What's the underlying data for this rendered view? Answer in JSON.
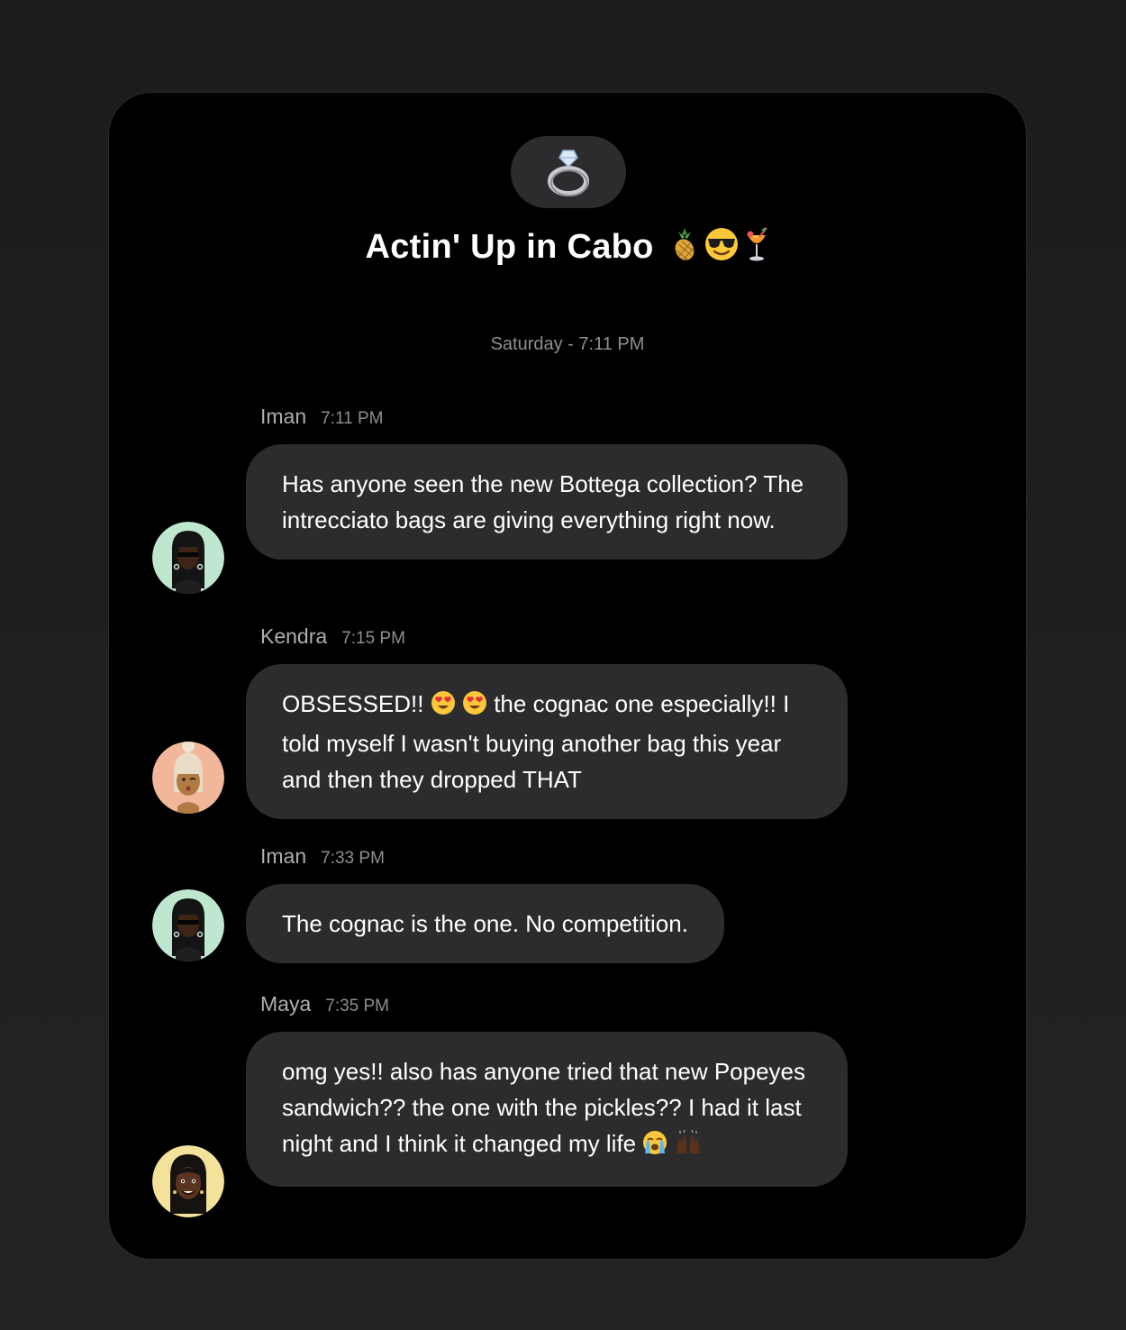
{
  "group": {
    "icon": "ring-icon",
    "title": "Actin' Up in Cabo",
    "title_emoji": [
      "pineapple-icon",
      "sunglasses-face-icon",
      "tropical-drink-icon"
    ]
  },
  "date_separator": "Saturday - 7:11 PM",
  "messages": [
    {
      "sender": "Iman",
      "time": "7:11 PM",
      "avatar": "iman-avatar",
      "text": "Has anyone seen the new Bottega collection? The intrecciato bags are giving everything right now."
    },
    {
      "sender": "Kendra",
      "time": "7:15 PM",
      "avatar": "kendra-avatar",
      "text_a": "OBSESSED!!",
      "text_b": "the cognac one especially!! I told myself I wasn't buying another bag this year and then they dropped THAT"
    },
    {
      "sender": "Iman",
      "time": "7:33 PM",
      "avatar": "iman-avatar",
      "text": "The cognac is the one. No competition."
    },
    {
      "sender": "Maya",
      "time": "7:35 PM",
      "avatar": "maya-avatar",
      "text": "omg yes!! also has anyone tried that new Popeyes sandwich?? the one with the pickles?? I had it last night and I think it changed my life"
    }
  ],
  "colors": {
    "background": "#1c1c1e",
    "window": "#000000",
    "bubble": "#2c2c2e",
    "iman_avatar_bg": "#bfe6cf",
    "kendra_avatar_bg": "#f2b79a",
    "maya_avatar_bg": "#f2e29a"
  }
}
